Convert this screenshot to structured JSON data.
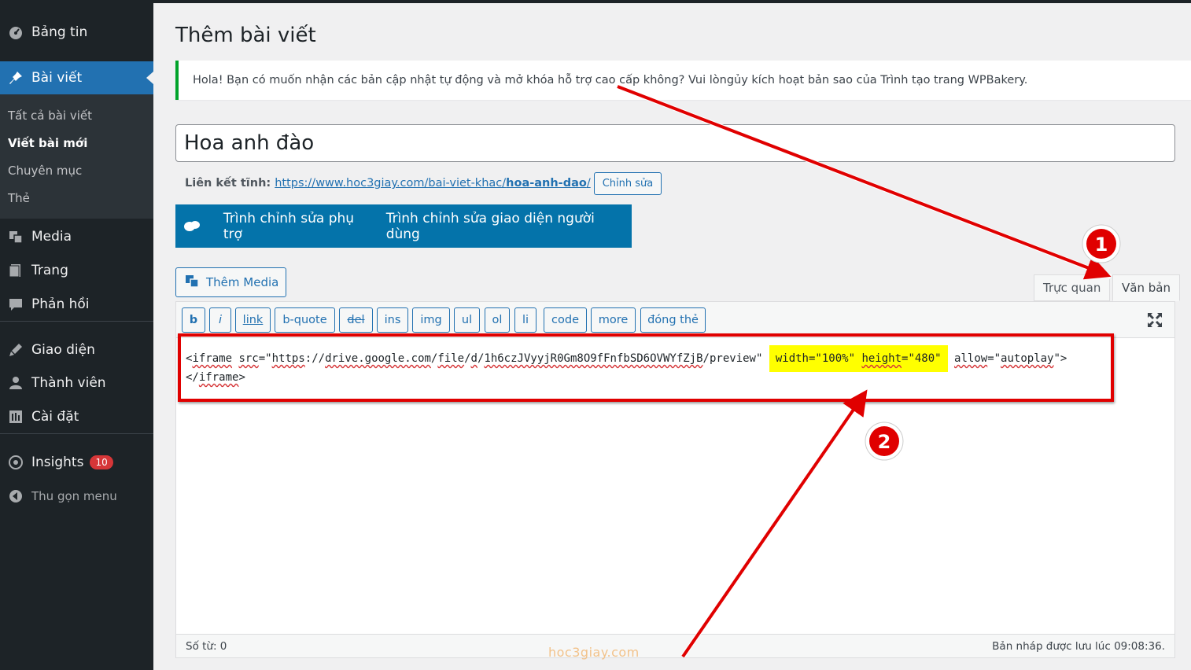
{
  "sidebar": {
    "dashboard": "Bảng tin",
    "posts": "Bài viết",
    "posts_sub": [
      "Tất cả bài viết",
      "Viết bài mới",
      "Chuyên mục",
      "Thẻ"
    ],
    "media": "Media",
    "pages": "Trang",
    "comments": "Phản hồi",
    "appearance": "Giao diện",
    "users": "Thành viên",
    "settings": "Cài đặt",
    "insights": "Insights",
    "insights_badge": "10",
    "collapse": "Thu gọn menu"
  },
  "page": {
    "title": "Thêm bài viết",
    "notice": "Hola! Bạn có muốn nhận các bản cập nhật tự động và mở khóa hỗ trợ cao cấp không? Vui lòngủy kích hoạt bản sao của Trình tạo trang WPBakery.",
    "post_title": "Hoa anh đào",
    "permalink_label": "Liên kết tĩnh:",
    "permalink_base": "https://www.hoc3giay.com/bai-viet-khac/",
    "permalink_slug": "hoa-anh-dao",
    "permalink_end": "/",
    "edit_button": "Chỉnh sửa"
  },
  "wpbakery": {
    "backend": "Trình chỉnh sửa phụ trợ",
    "frontend": "Trình chỉnh sửa giao diện người dùng"
  },
  "editor": {
    "add_media": "Thêm Media",
    "tab_visual": "Trực quan",
    "tab_text": "Văn bản",
    "quicktags": [
      "b",
      "i",
      "link",
      "b-quote",
      "del",
      "ins",
      "img",
      "ul",
      "ol",
      "li",
      "code",
      "more",
      "đóng thẻ"
    ],
    "code_tag_open": "<",
    "code_iframe": "iframe",
    "code_src_attr": "src",
    "code_src_prefix": "=\"",
    "code_url_1": "https",
    "code_url_2": "://",
    "code_url_3": "drive.google.com",
    "code_url_4": "/",
    "code_url_5": "file",
    "code_url_6": "/",
    "code_url_7": "d",
    "code_url_8": "/",
    "code_url_9": "1h6czJVyyjR0Gm8O9fFnfbSD6OVWYfZjB",
    "code_url_10": "/preview\" ",
    "code_highlight_width_attr": "width",
    "code_highlight_width_val": "=\"100%\" ",
    "code_highlight_height_attr": "height",
    "code_highlight_height_val": "=\"480\"",
    "code_allow_attr": "allow",
    "code_allow_eq": "=\"",
    "code_allow_val": "autoplay",
    "code_tag_end": "\">",
    "code_close_open": "</",
    "code_close_iframe": "iframe",
    "code_close_end": ">",
    "word_count": "Số từ: 0",
    "draft_saved": "Bản nháp được lưu lúc 09:08:36."
  },
  "annotations": {
    "marker_1": "1",
    "marker_2": "2",
    "watermark": "hoc3giay.com"
  },
  "colors": {
    "sidebar_bg": "#1d2327",
    "active_blue": "#2271b1",
    "wpbakery_blue": "#0473aa",
    "highlight": "#ffff00",
    "annotation_red": "#e00000"
  }
}
